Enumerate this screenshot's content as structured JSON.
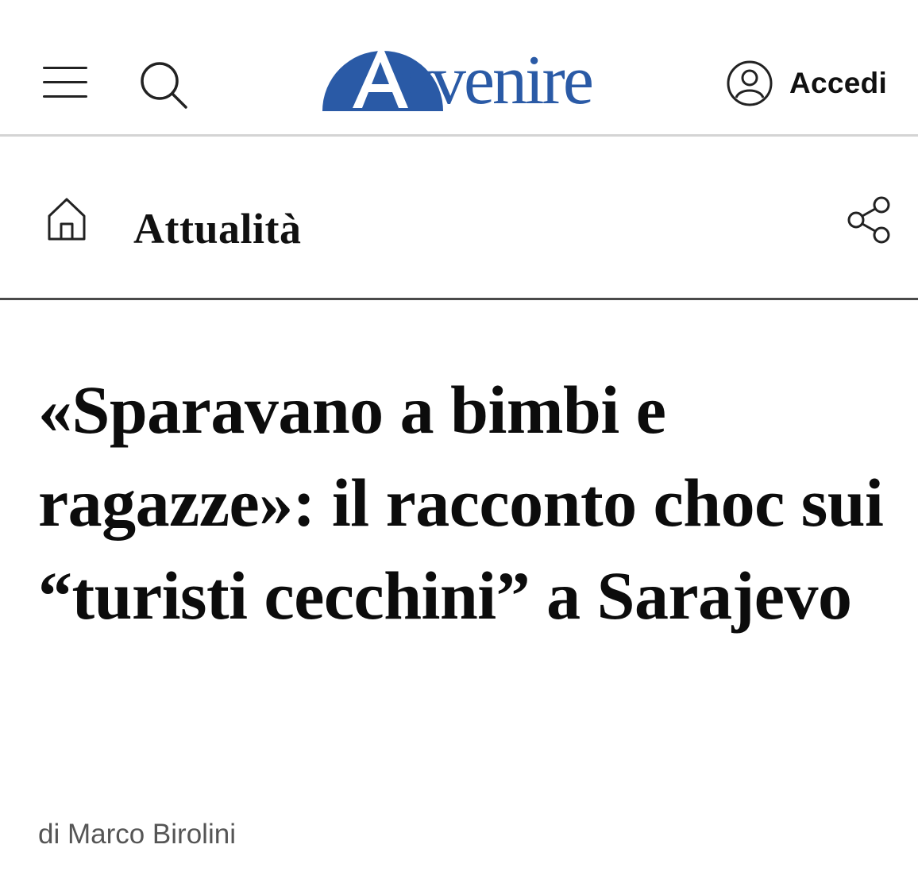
{
  "header": {
    "logo_text": "Avvenire",
    "login_label": "Accedi",
    "brand_color": "#2a5aa6",
    "icons": {
      "menu": "hamburger-menu-icon",
      "search": "search-icon",
      "user": "user-circle-icon"
    }
  },
  "section": {
    "title": "Attualità",
    "icons": {
      "home": "home-icon",
      "share": "share-icon"
    }
  },
  "article": {
    "headline": "«Sparavano a bimbi e ragazze»: il racconto choc sui “turisti cecchini” a Sarajevo",
    "byline": "di Marco Birolini"
  }
}
